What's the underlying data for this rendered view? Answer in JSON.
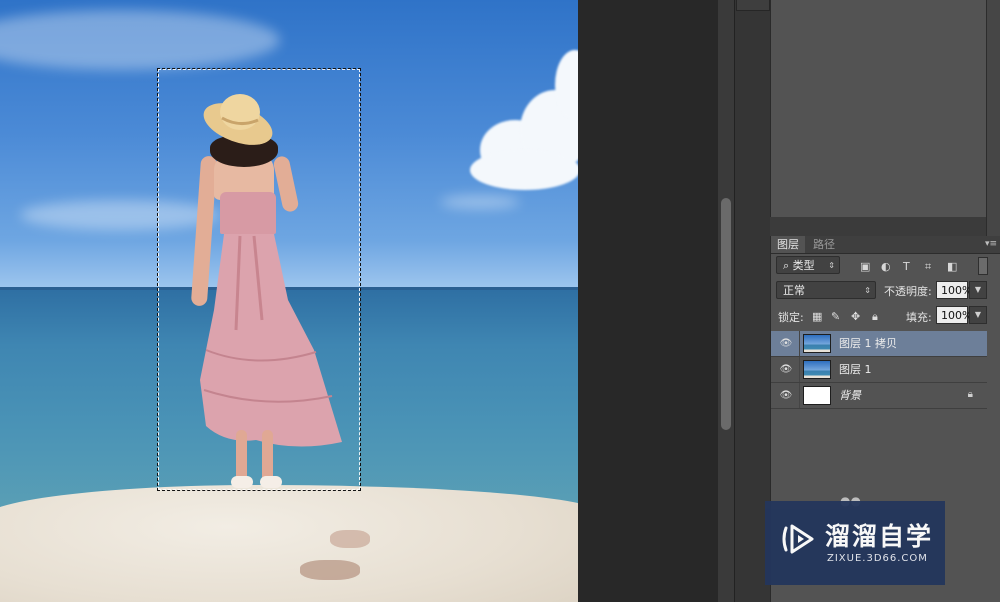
{
  "canvas": {
    "selection_visible": true
  },
  "layers_panel": {
    "tabs": [
      {
        "label": "图层",
        "active": true
      },
      {
        "label": "路径",
        "active": false
      }
    ],
    "filter": {
      "kind_label": "类型",
      "filter_icons": [
        "image-filter-icon",
        "adjustment-filter-icon",
        "type-filter-icon",
        "shape-filter-icon",
        "smart-object-filter-icon"
      ]
    },
    "blend_mode": "正常",
    "opacity_label": "不透明度:",
    "opacity_value": "100%",
    "lock_label": "锁定:",
    "lock_icons": [
      "lock-transparent-icon",
      "lock-pixels-icon",
      "lock-position-icon",
      "lock-all-icon"
    ],
    "fill_label": "填充:",
    "fill_value": "100%",
    "layers": [
      {
        "name": "图层 1 拷贝",
        "selected": true,
        "visible": true,
        "thumb": "sky",
        "locked": false
      },
      {
        "name": "图层 1",
        "selected": false,
        "visible": true,
        "thumb": "sky",
        "locked": false
      },
      {
        "name": "背景",
        "selected": false,
        "visible": true,
        "thumb": "white",
        "locked": true
      }
    ]
  },
  "watermark": {
    "title": "溜溜自学",
    "url": "ZIXUE.3D66.COM"
  }
}
